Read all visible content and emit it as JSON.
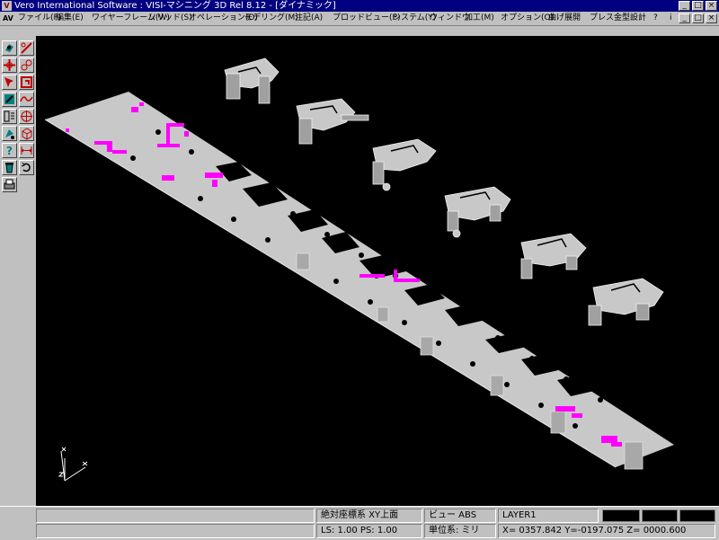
{
  "window": {
    "icon_text": "V",
    "title": "Vero International Software : VISI-マシニング 3D Rel 8.12 - [ダイナミック]",
    "minimize": "_",
    "maximize": "□",
    "close": "×"
  },
  "menubar": {
    "logo_text": "AV",
    "items": [
      "ファイル(F)",
      "編集(E)",
      "ワイヤーフレーム(W)",
      "ソリッド(S)",
      "オペレーション(O)",
      "モデリング(M)",
      "注記(A)",
      "プロッドビュー(P)",
      "システム(Y)",
      "ウィンドウ",
      "加工(M)",
      "オプション(O)",
      "曲げ展開",
      "プレス金型設計",
      "?",
      "i"
    ]
  },
  "toolbar": {
    "tools": [
      "view-rotate-icon",
      "edit-line-icon",
      "move-icon",
      "circle-icon",
      "select-icon",
      "corner-icon",
      "zoom-icon",
      "wave-icon",
      "layer-icon",
      "target-icon",
      "paint-icon",
      "box-icon",
      "help-icon",
      "measure-icon",
      "trash-icon",
      "undo-icon",
      "print-icon"
    ]
  },
  "statusbar": {
    "coord_system": "絶対座標系 XY上面",
    "view": "ビュー ABS",
    "layer": "LAYER1",
    "scale": "LS: 1.00 PS: 1.00",
    "units": "単位系: ミリ",
    "coordinates": "X= 0357.842 Y=-0197.075 Z= 0000.600"
  },
  "viewport": {
    "background": "#000000",
    "part_color": "#c8c8c8",
    "highlight_color": "#ff00ff",
    "axis_color": "#ffffff"
  }
}
